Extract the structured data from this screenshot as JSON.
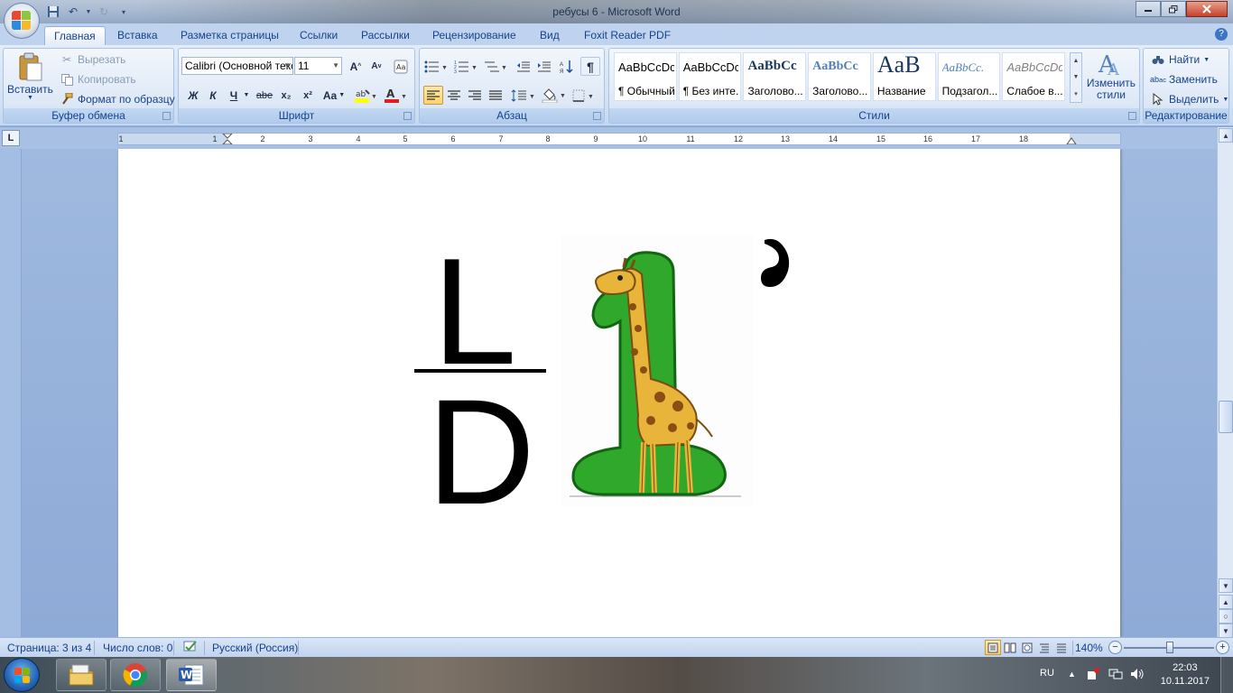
{
  "window": {
    "title": "ребусы 6 - Microsoft Word"
  },
  "ribbon_tabs": [
    "Главная",
    "Вставка",
    "Разметка страницы",
    "Ссылки",
    "Рассылки",
    "Рецензирование",
    "Вид",
    "Foxit Reader PDF"
  ],
  "active_tab": "Главная",
  "clipboard": {
    "paste": "Вставить",
    "cut": "Вырезать",
    "copy": "Копировать",
    "format_painter": "Формат по образцу",
    "label": "Буфер обмена"
  },
  "font": {
    "family": "Calibri (Основной текст)",
    "size": "11",
    "label": "Шрифт",
    "bold": "Ж",
    "italic": "К",
    "underline": "Ч",
    "strike": "abe",
    "subscript": "x₂",
    "superscript": "x²",
    "case": "Aa",
    "grow": "A",
    "shrink": "A"
  },
  "paragraph": {
    "label": "Абзац"
  },
  "styles": {
    "label": "Стили",
    "items": [
      {
        "sample": "AaBbCcDc",
        "name": "¶ Обычный"
      },
      {
        "sample": "AaBbCcDc",
        "name": "¶ Без инте..."
      },
      {
        "sample": "AaBbCc",
        "name": "Заголово..."
      },
      {
        "sample": "AaBbCc",
        "name": "Заголово..."
      },
      {
        "sample": "AaB",
        "name": "Название"
      },
      {
        "sample": "AaBbCc.",
        "name": "Подзагол..."
      },
      {
        "sample": "AaBbCcDc",
        "name": "Слабое в..."
      }
    ],
    "change": "Изменить стили"
  },
  "editing": {
    "label": "Редактирование",
    "find": "Найти",
    "replace": "Заменить",
    "select": "Выделить"
  },
  "ruler": {
    "corner": "L",
    "numbers": [
      "1",
      "1",
      "2",
      "3",
      "4",
      "5",
      "6",
      "7",
      "8",
      "9",
      "10",
      "11",
      "12",
      "13",
      "14",
      "15",
      "16",
      "17",
      "18"
    ]
  },
  "document": {
    "top_letter": "L",
    "bottom_letter": "D"
  },
  "status": {
    "page": "Страница: 3 из 4",
    "words": "Число слов: 0",
    "language": "Русский (Россия)",
    "zoom": "140%",
    "zoom_level_percent": 140
  },
  "taskbar": {
    "lang": "RU",
    "time": "22:03",
    "date": "10.11.2017"
  },
  "colors": {
    "accent": "#15428b",
    "giraffe_green": "#2fa82b",
    "giraffe_yellow": "#e8b43a"
  }
}
